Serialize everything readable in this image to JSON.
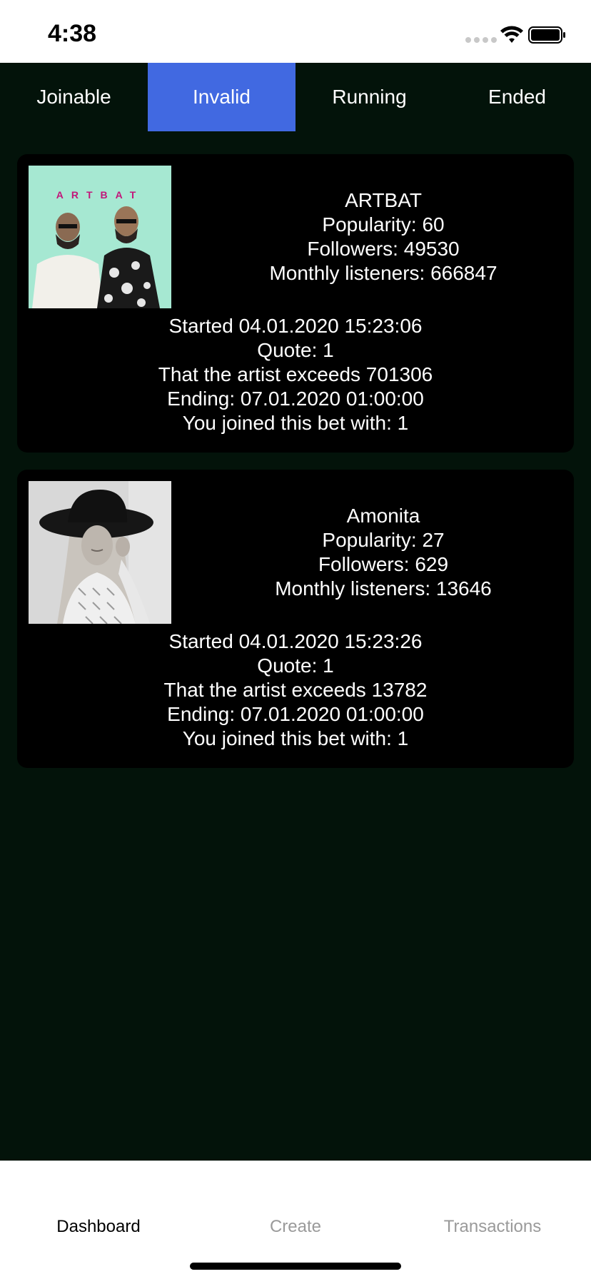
{
  "status_bar": {
    "time": "4:38"
  },
  "tabs": [
    {
      "label": "Joinable",
      "active": false
    },
    {
      "label": "Invalid",
      "active": true
    },
    {
      "label": "Running",
      "active": false
    },
    {
      "label": "Ended",
      "active": false
    }
  ],
  "bets": [
    {
      "artist": "ARTBAT",
      "art_text": "ARTBAT",
      "popularity": "Popularity: 60",
      "followers": "Followers: 49530",
      "monthly_listeners": "Monthly listeners: 666847",
      "started": "Started 04.01.2020 15:23:06",
      "quote": "Quote: 1",
      "condition": "That the artist exceeds 701306",
      "ending": "Ending: 07.01.2020 01:00:00",
      "joined": "You joined this bet with: 1"
    },
    {
      "artist": "Amonita",
      "popularity": "Popularity: 27",
      "followers": "Followers: 629",
      "monthly_listeners": "Monthly listeners: 13646",
      "started": "Started 04.01.2020 15:23:26",
      "quote": "Quote: 1",
      "condition": "That the artist exceeds 13782",
      "ending": "Ending: 07.01.2020 01:00:00",
      "joined": "You joined this bet with: 1"
    }
  ],
  "bottom_nav": [
    {
      "label": "Dashboard",
      "active": true
    },
    {
      "label": "Create",
      "active": false
    },
    {
      "label": "Transactions",
      "active": false
    }
  ],
  "colors": {
    "background": "#03130a",
    "card": "#000000",
    "active_tab": "#4169e1",
    "text": "#ffffff",
    "nav_inactive": "#9a9a9a"
  }
}
